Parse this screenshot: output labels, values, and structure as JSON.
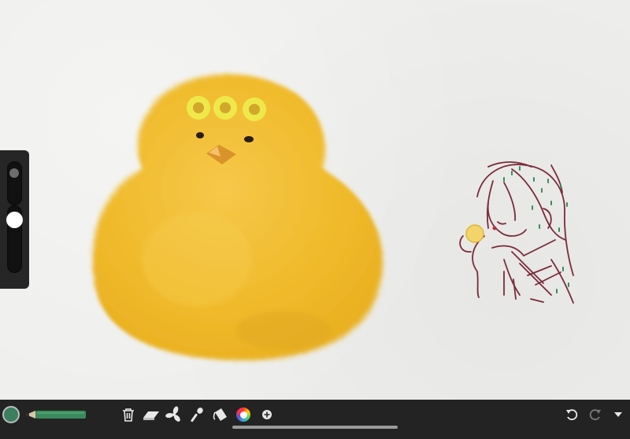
{
  "app": {
    "brush_color": "#3b7f5f",
    "toolbar": {
      "tools": [
        {
          "name": "color-swatch",
          "icon": "color-circle"
        },
        {
          "name": "pencil-tool",
          "icon": "pencil-icon"
        },
        {
          "name": "trash-button",
          "icon": "trash-icon"
        },
        {
          "name": "eraser-button",
          "icon": "eraser-icon"
        },
        {
          "name": "smudge-button",
          "icon": "fan-icon"
        },
        {
          "name": "airbrush-button",
          "icon": "airbrush-icon"
        },
        {
          "name": "fill-button",
          "icon": "bucket-icon"
        },
        {
          "name": "color-wheel-button",
          "icon": "color-wheel-icon"
        },
        {
          "name": "add-button",
          "icon": "plus-icon"
        },
        {
          "name": "undo-button",
          "icon": "undo-icon"
        },
        {
          "name": "redo-button",
          "icon": "redo-icon"
        },
        {
          "name": "menu-button",
          "icon": "chevron-down-icon"
        }
      ]
    },
    "sliders": {
      "brush_size_level": 0.1,
      "opacity_level": 0.15
    },
    "colors": {
      "toolbar_bg": "#232323",
      "canvas_bg": "#eeeeec",
      "chick_yellow": "#f0bd2e",
      "sketch_line": "#7a2b3a"
    }
  }
}
